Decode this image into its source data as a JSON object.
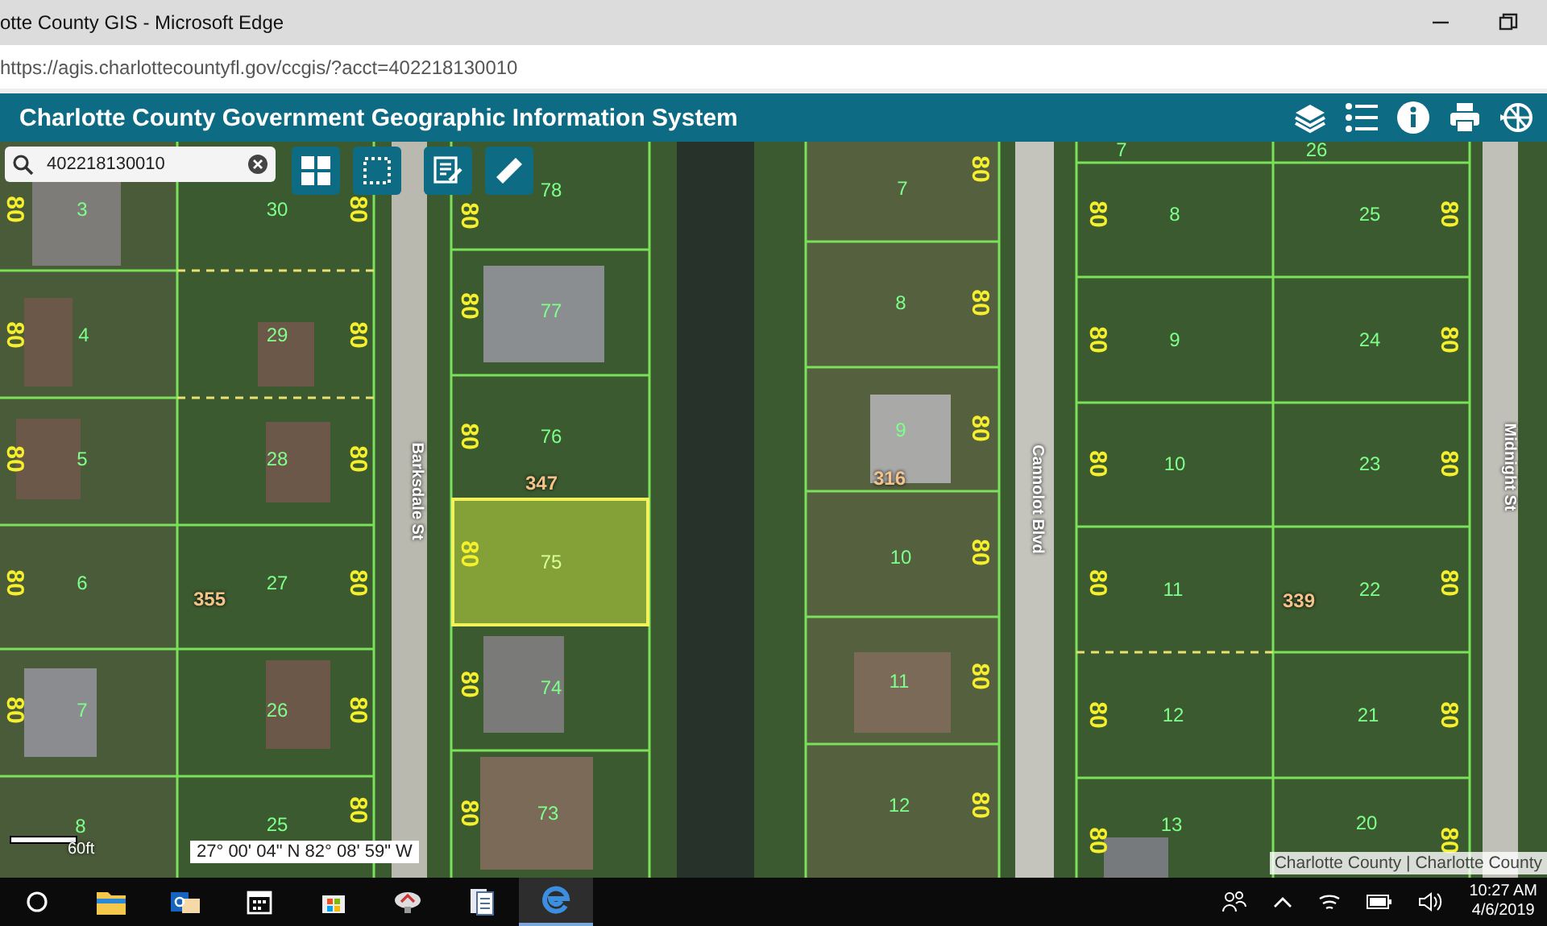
{
  "window": {
    "title": "otte County GIS - Microsoft Edge"
  },
  "address_bar": {
    "url": "https://agis.charlottecountyfl.gov/ccgis/?acct=402218130010"
  },
  "app_header": {
    "title": "Charlotte County Government Geographic Information System"
  },
  "search": {
    "value": "402218130010"
  },
  "map": {
    "lots": [
      {
        "number": "7",
        "selected": false
      },
      {
        "number": "26",
        "selected": false
      },
      {
        "number": "78",
        "selected": false
      },
      {
        "number": "7",
        "selected": false
      },
      {
        "number": "3",
        "selected": false
      },
      {
        "number": "30",
        "selected": false
      },
      {
        "number": "8",
        "selected": false
      },
      {
        "number": "25",
        "selected": false
      },
      {
        "number": "8",
        "selected": false
      },
      {
        "number": "77",
        "selected": false
      },
      {
        "number": "4",
        "selected": false
      },
      {
        "number": "29",
        "selected": false
      },
      {
        "number": "9",
        "selected": false
      },
      {
        "number": "24",
        "selected": false
      },
      {
        "number": "9",
        "selected": false
      },
      {
        "number": "76",
        "selected": false
      },
      {
        "number": "5",
        "selected": false
      },
      {
        "number": "28",
        "selected": false
      },
      {
        "number": "10",
        "selected": false
      },
      {
        "number": "23",
        "selected": false
      },
      {
        "number": "10",
        "selected": false
      },
      {
        "number": "75",
        "selected": true
      },
      {
        "number": "6",
        "selected": false
      },
      {
        "number": "27",
        "selected": false
      },
      {
        "number": "11",
        "selected": false
      },
      {
        "number": "22",
        "selected": false
      },
      {
        "number": "11",
        "selected": false
      },
      {
        "number": "74",
        "selected": false
      },
      {
        "number": "7",
        "selected": false
      },
      {
        "number": "26",
        "selected": false
      },
      {
        "number": "12",
        "selected": false
      },
      {
        "number": "21",
        "selected": false
      },
      {
        "number": "8",
        "selected": false
      },
      {
        "number": "25",
        "selected": false
      },
      {
        "number": "73",
        "selected": false
      },
      {
        "number": "12",
        "selected": false
      },
      {
        "number": "13",
        "selected": false
      },
      {
        "number": "20",
        "selected": false
      }
    ],
    "frontage_labels": [
      "80",
      "80",
      "80",
      "80",
      "80",
      "80",
      "80",
      "80",
      "80",
      "80",
      "80",
      "80",
      "80",
      "80",
      "80",
      "80",
      "80",
      "80",
      "80",
      "80",
      "80",
      "80",
      "80",
      "80",
      "80",
      "80",
      "80",
      "80",
      "80",
      "80",
      "80",
      "80",
      "80",
      "80",
      "80"
    ],
    "streets": [
      "Barksdale St",
      "Cannolot Blvd",
      "Midnight St"
    ],
    "distances": [
      "347",
      "316",
      "355",
      "339"
    ],
    "scale_label": "60ft",
    "coordinates": "27° 00' 04\" N 82° 08' 59\" W",
    "attribution": "Charlotte County | Charlotte County"
  },
  "taskbar": {
    "apps": [
      {
        "kind": "folder",
        "selected": false
      },
      {
        "kind": "mail",
        "selected": false
      },
      {
        "kind": "calendar",
        "selected": false
      },
      {
        "kind": "store",
        "selected": false
      },
      {
        "kind": "app",
        "selected": false
      },
      {
        "kind": "document",
        "selected": false
      },
      {
        "kind": "browser",
        "selected": true
      }
    ],
    "time": "10:27 AM",
    "date": "4/6/2019"
  }
}
